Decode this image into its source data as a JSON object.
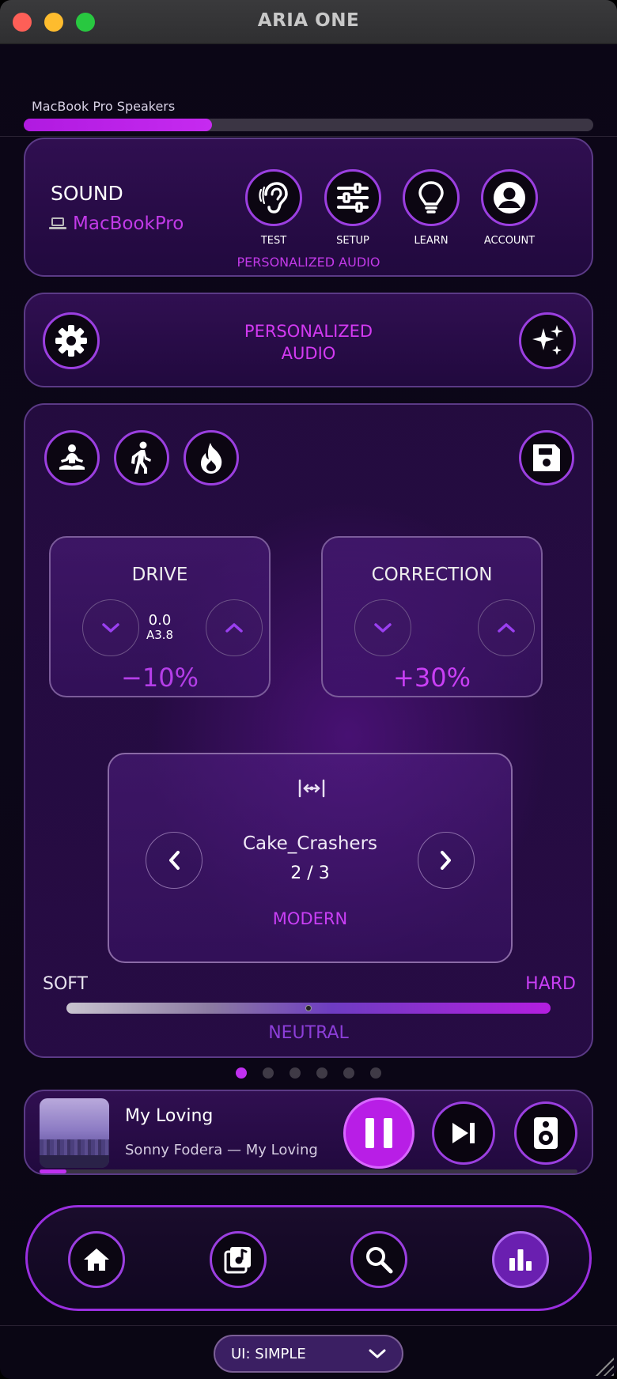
{
  "window": {
    "title": "ARIA ONE"
  },
  "output": {
    "device_label": "MacBook Pro Speakers",
    "level_fraction": 0.33
  },
  "sound_panel": {
    "title": "SOUND",
    "device_name": "MacBookPro",
    "buttons": [
      {
        "label": "TEST",
        "icon": "ear-icon"
      },
      {
        "label": "SETUP",
        "icon": "sliders-icon"
      },
      {
        "label": "LEARN",
        "icon": "lightbulb-icon"
      },
      {
        "label": "ACCOUNT",
        "icon": "user-circle-icon"
      }
    ],
    "caption": "PERSONALIZED AUDIO"
  },
  "personalized_panel": {
    "line1": "PERSONALIZED",
    "line2": "AUDIO"
  },
  "tuning": {
    "modes": [
      "meditation-icon",
      "walking-icon",
      "flame-icon"
    ],
    "drive": {
      "title": "DRIVE",
      "value_main": "0.0",
      "value_sub": "A3.8",
      "percent": "−10%"
    },
    "correction": {
      "title": "CORRECTION",
      "percent": "+30%"
    },
    "preset": {
      "name": "Cake_Crashers",
      "position": "2 / 3",
      "style": "MODERN"
    },
    "slider": {
      "left_label": "SOFT",
      "right_label": "HARD",
      "center_label": "NEUTRAL",
      "position_fraction": 0.5
    }
  },
  "pager": {
    "count": 6,
    "active_index": 0
  },
  "player": {
    "title": "My Loving",
    "subtitle": "Sonny Fodera — My Loving",
    "progress_fraction": 0.05
  },
  "bottom_nav": {
    "items": [
      "home-icon",
      "music-library-icon",
      "search-icon",
      "equalizer-icon"
    ],
    "active_index": 3
  },
  "ui_mode": {
    "label": "UI: SIMPLE"
  },
  "colors": {
    "accent": "#c030f0",
    "accent_text": "#c93ff5",
    "ring": "#9b3fe0"
  }
}
